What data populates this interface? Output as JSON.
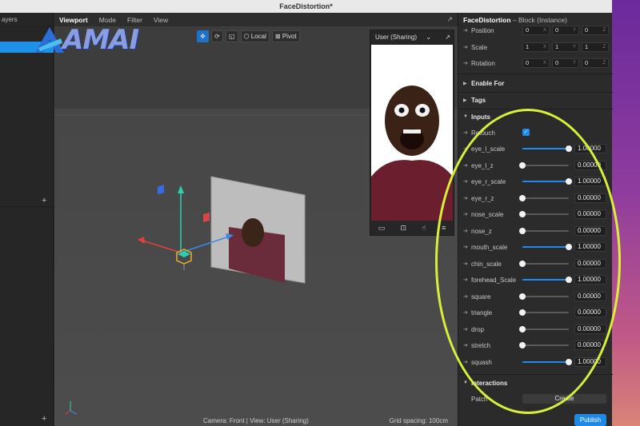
{
  "window": {
    "title": "FaceDistortion*"
  },
  "left_panel": {
    "header": "ayers",
    "add_label_1": "+",
    "add_label_2": "+"
  },
  "logo": {
    "text": "AMAI"
  },
  "viewport": {
    "menu": [
      "Viewport",
      "Mode",
      "Filter",
      "View"
    ],
    "toolbar": {
      "local_label": "Local",
      "pivot_label": "Pivot"
    },
    "status_camera": "Camera: Front | View: User (Sharing)",
    "status_grid": "Grid spacing: 100cm"
  },
  "preview": {
    "title": "User (Sharing)"
  },
  "inspector": {
    "title": "FaceDistortion",
    "subtitle": "– Block (Instance)",
    "transform": [
      {
        "label": "Position",
        "values": [
          "0",
          "0",
          "0"
        ],
        "axes": [
          "X",
          "Y",
          "Z"
        ]
      },
      {
        "label": "Scale",
        "values": [
          "1",
          "1",
          "1"
        ],
        "axes": [
          "X",
          "Y",
          "Z"
        ]
      },
      {
        "label": "Rotation",
        "values": [
          "0",
          "0",
          "0"
        ],
        "axes": [
          "X",
          "Y",
          "Z"
        ]
      }
    ],
    "sections": {
      "enable_for": "Enable For",
      "tags": "Tags",
      "inputs": "Inputs",
      "interactions": "Interactions"
    },
    "retouch_label": "Retouch",
    "inputs": [
      {
        "label": "eye_l_scale",
        "value": "1.00000",
        "fill": 1.0
      },
      {
        "label": "eye_l_z",
        "value": "0.00000",
        "fill": 0.0
      },
      {
        "label": "eye_r_scale",
        "value": "1.00000",
        "fill": 1.0
      },
      {
        "label": "eye_r_z",
        "value": "0.00000",
        "fill": 0.0
      },
      {
        "label": "nose_scale",
        "value": "0.00000",
        "fill": 0.0
      },
      {
        "label": "nose_z",
        "value": "0.00000",
        "fill": 0.0
      },
      {
        "label": "mouth_scale",
        "value": "1.00000",
        "fill": 1.0
      },
      {
        "label": "chin_scale",
        "value": "0.00000",
        "fill": 0.0
      },
      {
        "label": "forehead_Scale",
        "value": "1.00000",
        "fill": 1.0
      },
      {
        "label": "square",
        "value": "0.00000",
        "fill": 0.0
      },
      {
        "label": "triangle",
        "value": "0.00000",
        "fill": 0.0
      },
      {
        "label": "drop",
        "value": "0.00000",
        "fill": 0.0
      },
      {
        "label": "stretch",
        "value": "0.00000",
        "fill": 0.0
      },
      {
        "label": "squash",
        "value": "1.00000",
        "fill": 1.0
      }
    ],
    "patch_label": "Patch",
    "create_label": "Create",
    "publish_label": "Publish"
  },
  "colors": {
    "accent": "#1f8bf0",
    "highlight": "#d8f03a",
    "viewport_bg": "#3d3d3d",
    "panel_bg": "#2b2b2b"
  }
}
